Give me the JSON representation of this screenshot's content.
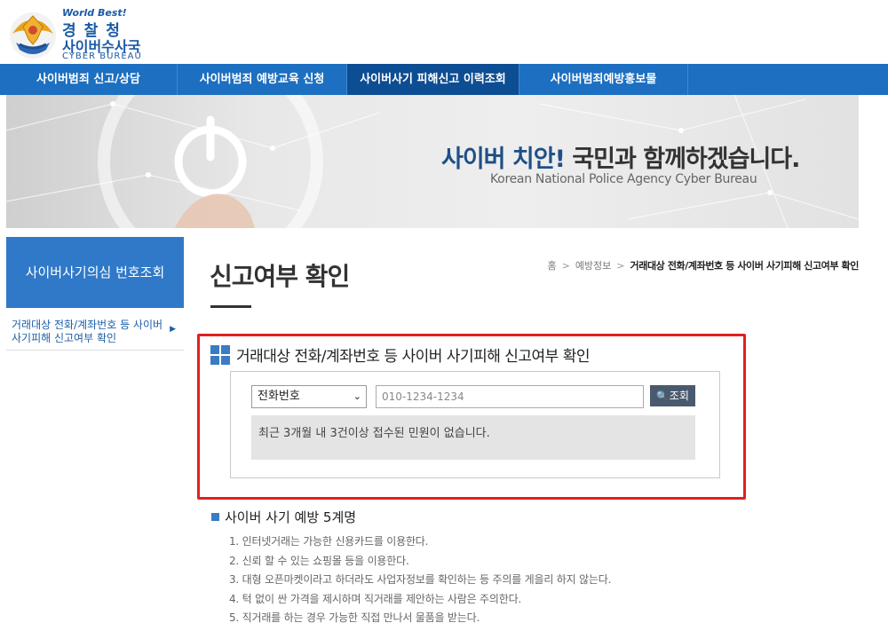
{
  "logo": {
    "tagline": "World Best!",
    "agency": "경찰청",
    "bureau": "사이버수사국",
    "english": "CYBER BUREAU"
  },
  "nav": {
    "items": [
      {
        "label": "사이버범죄 신고/상담"
      },
      {
        "label": "사이버범죄 예방교육 신청"
      },
      {
        "label": "사이버사기 피해신고 이력조회"
      },
      {
        "label": "사이버범죄예방홍보물"
      }
    ],
    "active_index": 2
  },
  "banner": {
    "title_highlight": "사이버 치안!",
    "title_rest": " 국민과 함께하겠습니다.",
    "subtitle": "Korean National Police Agency Cyber Bureau"
  },
  "sidebar": {
    "title": "사이버사기의심 번호조회",
    "items": [
      {
        "label": "거래대상 전화/계좌번호 등 사이버 사기피해 신고여부 확인"
      }
    ]
  },
  "page": {
    "title": "신고여부 확인"
  },
  "breadcrumb": {
    "home": "홈",
    "level1": "예방정보",
    "current": "거래대상 전화/계좌번호 등 사이버 사기피해 신고여부 확인"
  },
  "lookup": {
    "section_title": "거래대상 전화/계좌번호 등 사이버 사기피해 신고여부 확인",
    "select_value": "전화번호",
    "input_value": "010-1234-1234",
    "search_label": "조회",
    "result_text": "최근 3개월 내 3건이상 접수된 민원이 없습니다."
  },
  "tips": {
    "title": "사이버 사기 예방 5계명",
    "items": [
      "1. 인터넷거래는 가능한 신용카드를 이용한다.",
      "2. 신뢰 할 수 있는 쇼핑몰 등을 이용한다.",
      "3. 대형 오픈마켓이라고 하더라도 사업자정보를 확인하는 등 주의를 게을리 하지 않는다.",
      "4. 턱 없이 싼 가격을 제시하며 직거래를 제안하는 사람은 주의한다.",
      "5. 직거래를 하는 경우 가능한 직접 만나서 물품을 받는다."
    ]
  },
  "colors": {
    "nav_bg": "#1c6fc1",
    "nav_active": "#0d4d93",
    "sidebar_title_bg": "#2f79c8",
    "highlight_border": "#e02020",
    "search_button": "#4a5a6e"
  }
}
